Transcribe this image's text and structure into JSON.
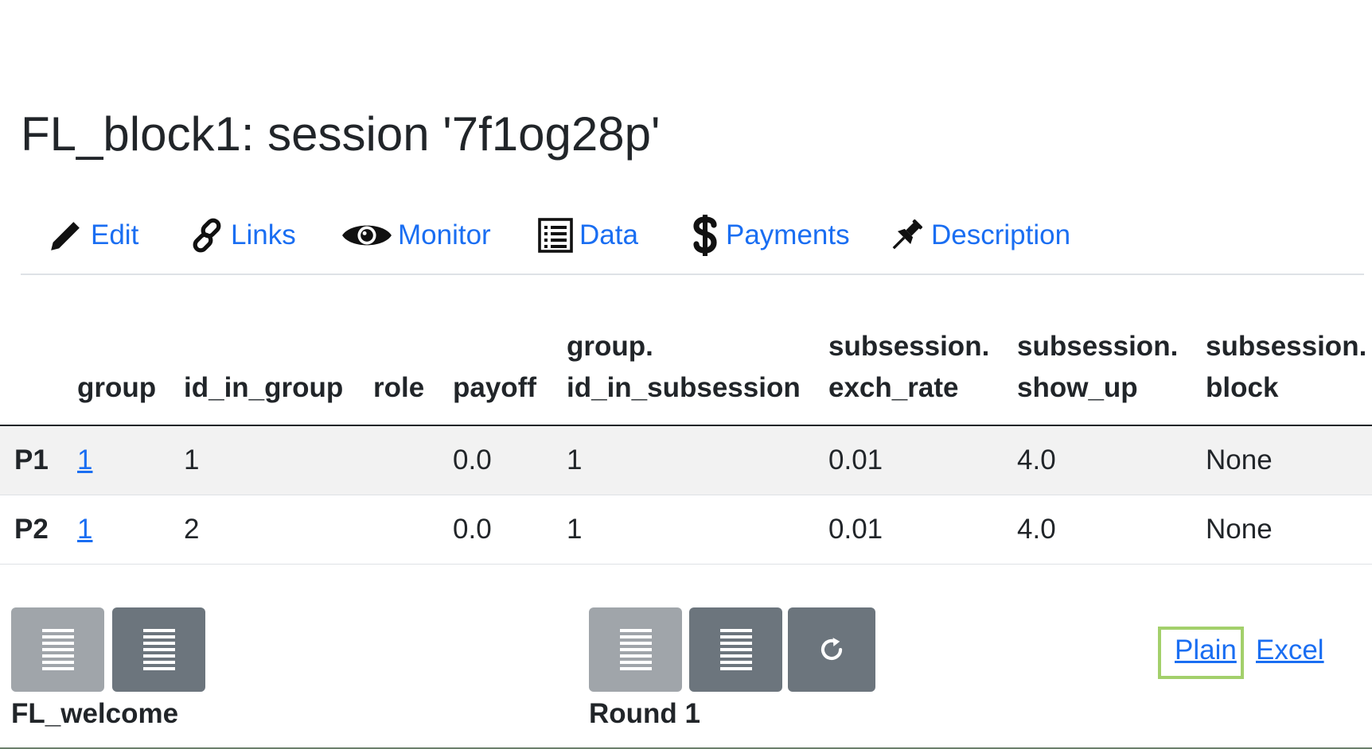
{
  "page": {
    "title": "FL_block1: session '7f1og28p'"
  },
  "nav": {
    "items": [
      {
        "label": "Edit",
        "icon": "pencil-icon"
      },
      {
        "label": "Links",
        "icon": "link-icon"
      },
      {
        "label": "Monitor",
        "icon": "eye-icon"
      },
      {
        "label": "Data",
        "icon": "list-document-icon"
      },
      {
        "label": "Payments",
        "icon": "dollar-icon"
      },
      {
        "label": "Description",
        "icon": "pushpin-icon"
      }
    ],
    "link_color": "#1a6ef2"
  },
  "table": {
    "headers": [
      {
        "line1": "",
        "line2": ""
      },
      {
        "line1": "",
        "line2": "group"
      },
      {
        "line1": "",
        "line2": "id_in_group"
      },
      {
        "line1": "",
        "line2": "role"
      },
      {
        "line1": "",
        "line2": "payoff"
      },
      {
        "line1": "group.",
        "line2": "id_in_subsession"
      },
      {
        "line1": "subsession.",
        "line2": "exch_rate"
      },
      {
        "line1": "subsession.",
        "line2": "show_up"
      },
      {
        "line1": "subsession.",
        "line2": "block"
      }
    ],
    "rows": [
      {
        "label": "P1",
        "group": "1",
        "id_in_group": "1",
        "role": "",
        "payoff": "0.0",
        "id_in_subsession": "1",
        "exch_rate": "0.01",
        "show_up": "4.0",
        "block": "None"
      },
      {
        "label": "P2",
        "group": "1",
        "id_in_group": "2",
        "role": "",
        "payoff": "0.0",
        "id_in_subsession": "1",
        "exch_rate": "0.01",
        "show_up": "4.0",
        "block": "None"
      }
    ]
  },
  "footer": {
    "app_label": "FL_welcome",
    "round_label": "Round 1",
    "buttons": {
      "app_prev_icon": "list-lines-icon",
      "app_next_icon": "list-lines-icon",
      "round_prev_icon": "list-lines-icon",
      "round_next_icon": "list-lines-icon",
      "refresh_icon": "refresh-icon"
    },
    "export_plain": "Plain",
    "export_excel": "Excel"
  }
}
